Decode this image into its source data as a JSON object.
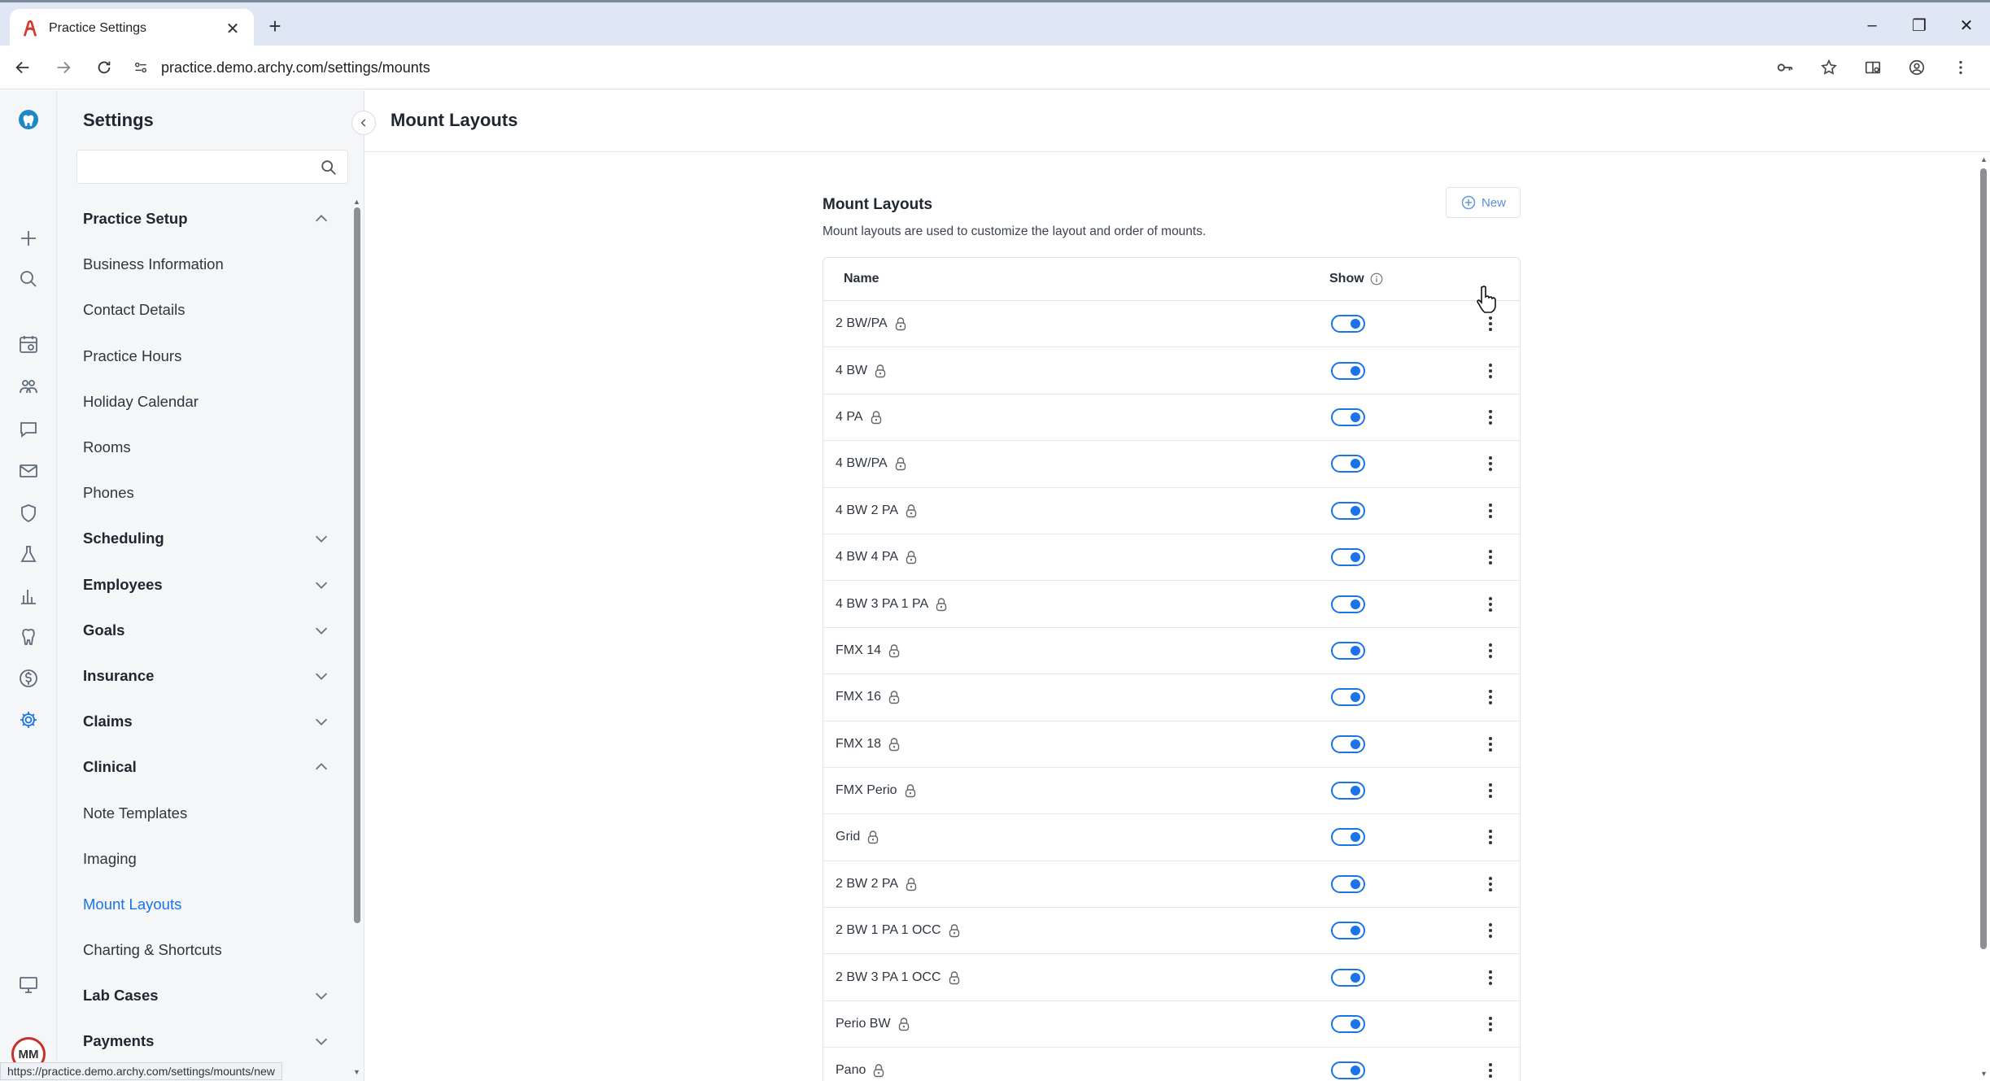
{
  "browser": {
    "tab_title": "Practice Settings",
    "url": "practice.demo.archy.com/settings/mounts",
    "status_url": "https://practice.demo.archy.com/settings/mounts/new"
  },
  "user": {
    "initials": "MM"
  },
  "sidebar": {
    "title": "Settings",
    "search_placeholder": "",
    "items": [
      {
        "label": "Practice Setup",
        "type": "section",
        "expanded": true
      },
      {
        "label": "Business Information",
        "type": "item"
      },
      {
        "label": "Contact Details",
        "type": "item"
      },
      {
        "label": "Practice Hours",
        "type": "item"
      },
      {
        "label": "Holiday Calendar",
        "type": "item"
      },
      {
        "label": "Rooms",
        "type": "item"
      },
      {
        "label": "Phones",
        "type": "item"
      },
      {
        "label": "Scheduling",
        "type": "section",
        "expanded": false
      },
      {
        "label": "Employees",
        "type": "section",
        "expanded": false
      },
      {
        "label": "Goals",
        "type": "section",
        "expanded": false
      },
      {
        "label": "Insurance",
        "type": "section",
        "expanded": false
      },
      {
        "label": "Claims",
        "type": "section",
        "expanded": false
      },
      {
        "label": "Clinical",
        "type": "section",
        "expanded": true
      },
      {
        "label": "Note Templates",
        "type": "item"
      },
      {
        "label": "Imaging",
        "type": "item"
      },
      {
        "label": "Mount Layouts",
        "type": "item",
        "active": true
      },
      {
        "label": "Charting & Shortcuts",
        "type": "item"
      },
      {
        "label": "Lab Cases",
        "type": "section",
        "expanded": false
      },
      {
        "label": "Payments",
        "type": "section",
        "expanded": false
      }
    ]
  },
  "main": {
    "header_title": "Mount Layouts",
    "panel_title": "Mount Layouts",
    "panel_desc": "Mount layouts are used to customize the layout and order of mounts.",
    "new_label": "New",
    "table": {
      "col_name": "Name",
      "col_show": "Show",
      "rows": [
        {
          "name": "2 BW/PA",
          "show": true
        },
        {
          "name": "4 BW",
          "show": true
        },
        {
          "name": "4 PA",
          "show": true
        },
        {
          "name": "4 BW/PA",
          "show": true
        },
        {
          "name": "4 BW 2 PA",
          "show": true
        },
        {
          "name": "4 BW 4 PA",
          "show": true
        },
        {
          "name": "4 BW 3 PA 1 PA",
          "show": true
        },
        {
          "name": "FMX 14",
          "show": true
        },
        {
          "name": "FMX 16",
          "show": true
        },
        {
          "name": "FMX 18",
          "show": true
        },
        {
          "name": "FMX Perio",
          "show": true
        },
        {
          "name": "Grid",
          "show": true
        },
        {
          "name": "2 BW 2 PA",
          "show": true
        },
        {
          "name": "2 BW 1 PA 1 OCC",
          "show": true
        },
        {
          "name": "2 BW 3 PA 1 OCC",
          "show": true
        },
        {
          "name": "Perio BW",
          "show": true
        },
        {
          "name": "Pano",
          "show": true
        }
      ]
    }
  },
  "colors": {
    "accent": "#1a73e8",
    "brand": "#c5322e",
    "rail_bg": "#f4f6f8"
  }
}
